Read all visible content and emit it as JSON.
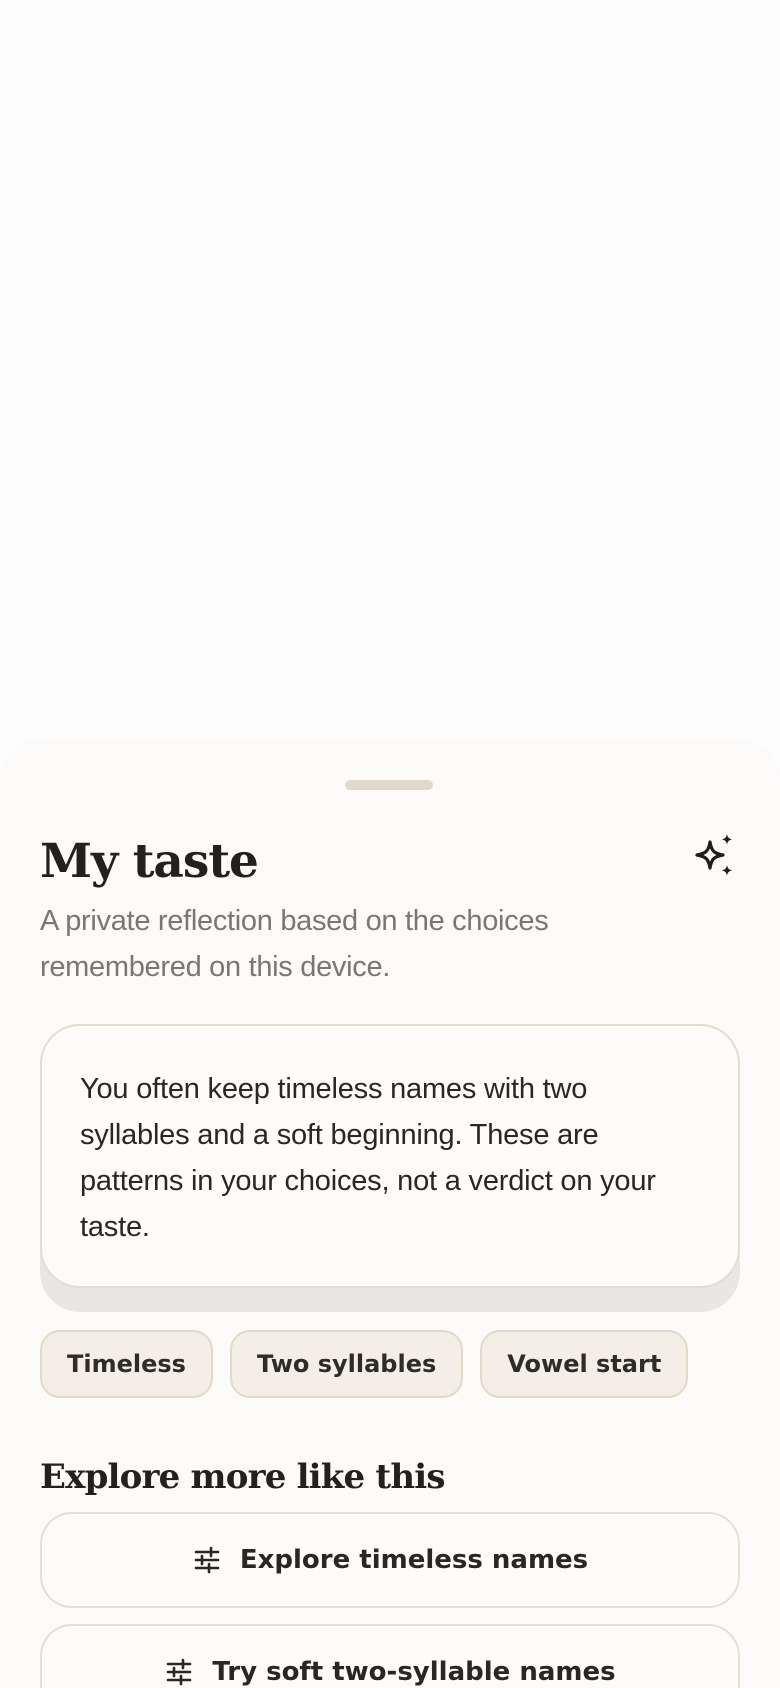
{
  "sheet": {
    "title": "My taste",
    "subtitle": "A private reflection based on the choices remembered on this device.",
    "header_icon": "sparkles-icon",
    "insight": "You often keep timeless names with two syllables and a soft beginning. These are patterns in your choices, not a verdict on your taste.",
    "tags": [
      "Timeless",
      "Two syllables",
      "Vowel start"
    ],
    "explore": {
      "title": "Explore more like this",
      "actions": [
        {
          "label": "Explore timeless names",
          "icon": "sliders-icon"
        },
        {
          "label": "Try soft two-syllable names",
          "icon": "sliders-icon"
        }
      ]
    }
  },
  "colors": {
    "background": "#fefdfd",
    "sheet": "#fcfbf9",
    "text": "#23201d",
    "muted_text": "#7c7671",
    "chip_fill": "#f4efe6",
    "chip_border": "#e2d9c9",
    "grabber": "#e3d8cc"
  }
}
